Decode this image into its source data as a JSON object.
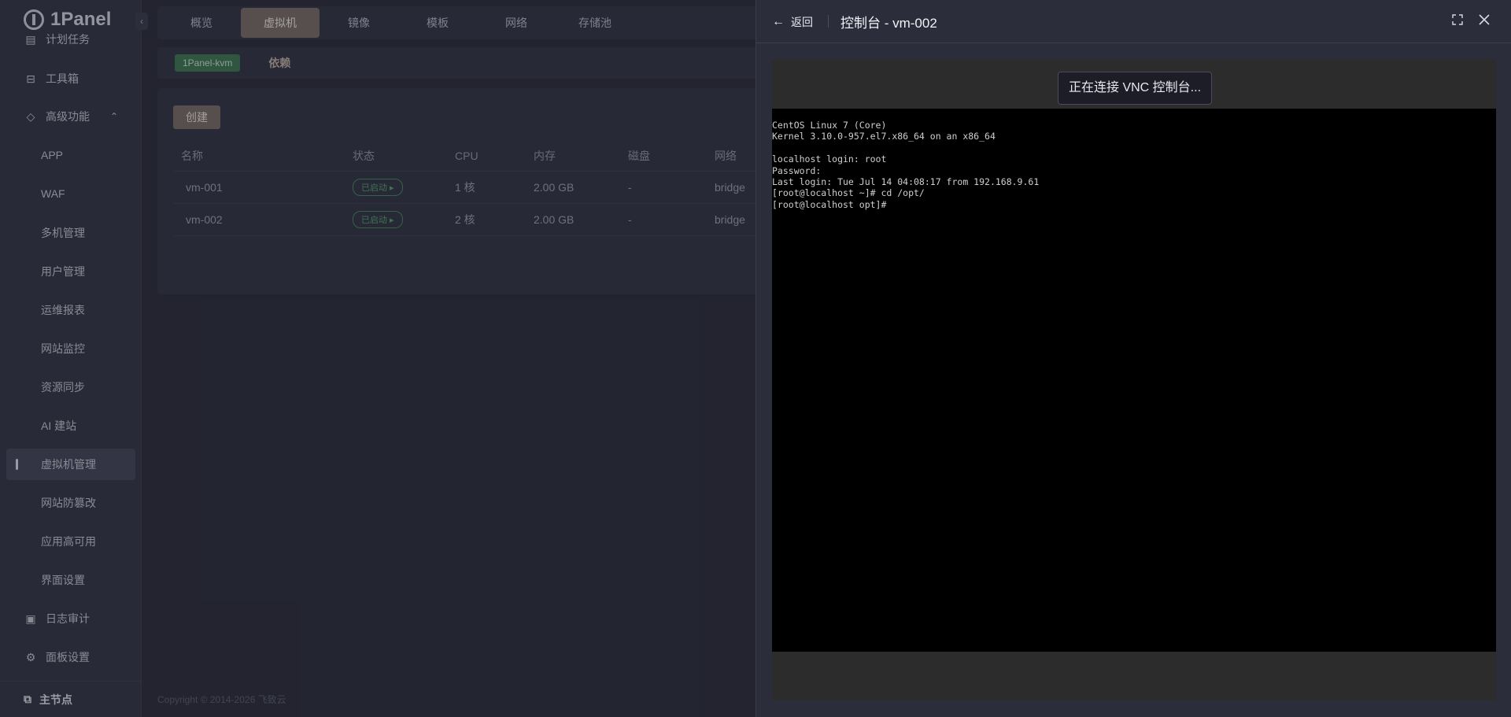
{
  "app": {
    "logo_text": "1Panel",
    "sidebar": {
      "items": [
        {
          "label": "计划任务"
        },
        {
          "label": "工具箱"
        },
        {
          "label": "高级功能"
        },
        {
          "label": "APP"
        },
        {
          "label": "WAF"
        },
        {
          "label": "多机管理"
        },
        {
          "label": "用户管理"
        },
        {
          "label": "运维报表"
        },
        {
          "label": "网站监控"
        },
        {
          "label": "资源同步"
        },
        {
          "label": "AI 建站"
        },
        {
          "label": "虚拟机管理"
        },
        {
          "label": "网站防篡改"
        },
        {
          "label": "应用高可用"
        },
        {
          "label": "界面设置"
        },
        {
          "label": "日志审计"
        },
        {
          "label": "面板设置"
        }
      ],
      "footer": "主节点"
    },
    "tabs": [
      {
        "label": "概览"
      },
      {
        "label": "虚拟机"
      },
      {
        "label": "镜像"
      },
      {
        "label": "模板"
      },
      {
        "label": "网络"
      },
      {
        "label": "存储池"
      }
    ],
    "subbar": {
      "badge": "1Panel-kvm",
      "dependency": "依赖"
    },
    "create_label": "创建",
    "table": {
      "headers": [
        "名称",
        "状态",
        "CPU",
        "内存",
        "磁盘",
        "网络"
      ],
      "rows": [
        {
          "name": "vm-001",
          "status": "已启动",
          "cpu": "1 核",
          "memory": "2.00 GB",
          "disk": "-",
          "network": "bridge"
        },
        {
          "name": "vm-002",
          "status": "已启动",
          "cpu": "2 核",
          "memory": "2.00 GB",
          "disk": "-",
          "network": "bridge"
        }
      ]
    },
    "copyright": "Copyright © 2014-2026 飞致云"
  },
  "drawer": {
    "back_label": "返回",
    "title": "控制台 - vm-002",
    "vnc_status": "正在连接 VNC 控制台...",
    "console_lines": [
      "CentOS Linux 7 (Core)",
      "Kernel 3.10.0-957.el7.x86_64 on an x86_64",
      "",
      "localhost login: root",
      "Password:",
      "Last login: Tue Jul 14 04:08:17 from 192.168.9.61",
      "[root@localhost ~]# cd /opt/",
      "[root@localhost opt]#"
    ]
  },
  "colors": {
    "accent_brown": "#7a6f68",
    "status_green": "#58a36d",
    "drawer_bg": "#2b2d3b",
    "console_bg": "#000000"
  }
}
